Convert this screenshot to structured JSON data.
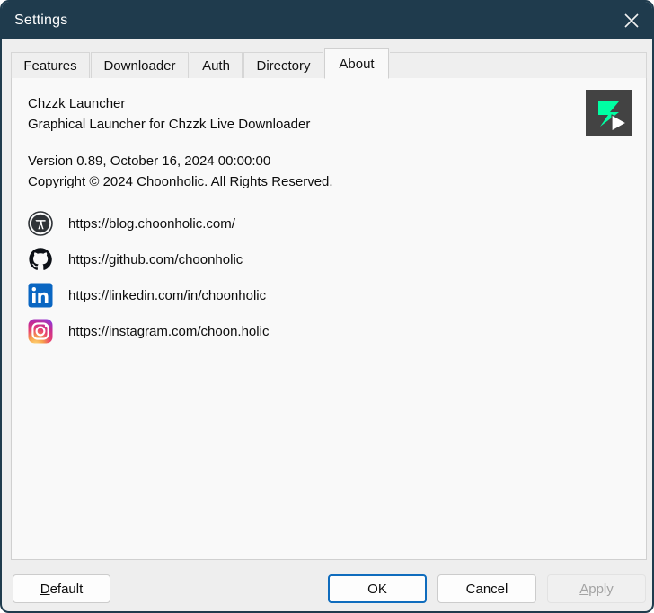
{
  "window": {
    "title": "Settings",
    "close_icon": "close-icon",
    "titlebar_color": "#1f3b4d"
  },
  "tabs": [
    {
      "label": "Features",
      "selected": false
    },
    {
      "label": "Downloader",
      "selected": false
    },
    {
      "label": "Auth",
      "selected": false
    },
    {
      "label": "Directory",
      "selected": false
    },
    {
      "label": "About",
      "selected": true
    }
  ],
  "about": {
    "app_name": "Chzzk Launcher",
    "app_description": "Graphical Launcher for Chzzk Live Downloader",
    "version_line": "Version 0.89, October 16, 2024 00:00:00",
    "copyright_line": "Copyright © 2024 Choonholic. All Rights Reserved.",
    "logo": {
      "icon": "chzzk-logo-icon",
      "background_color": "#434343",
      "accent_color": "#00ffa3"
    },
    "links": [
      {
        "icon": "wordpress-icon",
        "url": "https://blog.choonholic.com/",
        "color": "#2f3337"
      },
      {
        "icon": "github-icon",
        "url": "https://github.com/choonholic",
        "color": "#0d1117"
      },
      {
        "icon": "linkedin-icon",
        "url": "https://linkedin.com/in/choonholic",
        "color": "#0a66c2"
      },
      {
        "icon": "instagram-icon",
        "url": "https://instagram.com/choon.holic",
        "color": "#d62976"
      }
    ]
  },
  "footer": {
    "default_label_accel": "D",
    "default_label_rest": "efault",
    "ok_label": "OK",
    "cancel_label": "Cancel",
    "apply_label_accel": "A",
    "apply_label_rest": "pply",
    "apply_enabled": false,
    "primary_button": "OK",
    "accent_color": "#0f6cbd"
  }
}
